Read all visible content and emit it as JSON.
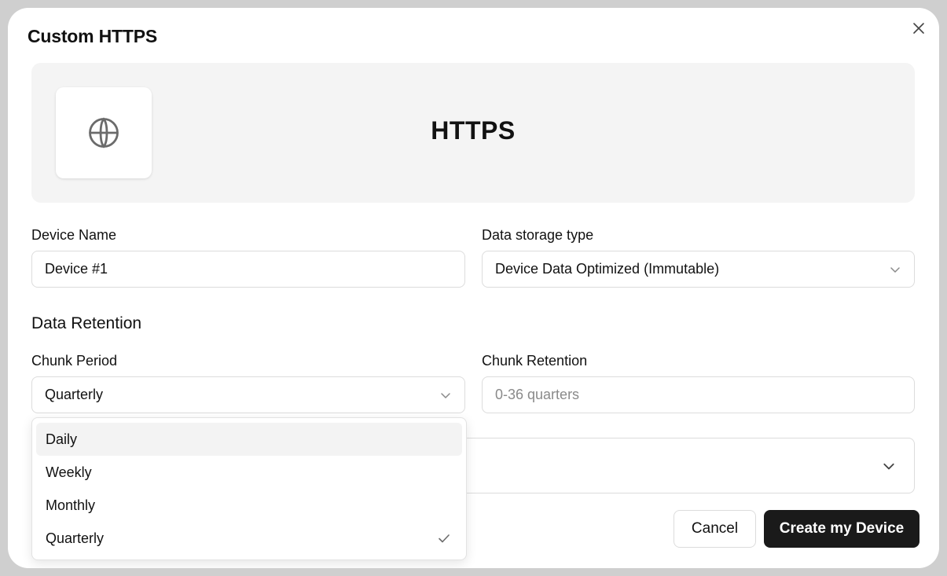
{
  "dialog": {
    "title": "Custom HTTPS",
    "close_icon": "close-icon"
  },
  "hero": {
    "icon": "globe-icon",
    "title": "HTTPS"
  },
  "device_name": {
    "label": "Device Name",
    "value": "Device #1"
  },
  "storage_type": {
    "label": "Data storage type",
    "value": "Device Data Optimized (Immutable)"
  },
  "retention": {
    "section_title": "Data Retention",
    "chunk_period": {
      "label": "Chunk Period",
      "value": "Quarterly",
      "options": [
        "Daily",
        "Weekly",
        "Monthly",
        "Quarterly"
      ],
      "highlighted": "Daily",
      "selected": "Quarterly"
    },
    "chunk_retention": {
      "label": "Chunk Retention",
      "placeholder": "0-36 quarters"
    }
  },
  "actions": {
    "cancel_label": "Cancel",
    "create_label": "Create my Device"
  },
  "colors": {
    "primary_button": "#1a1a1a",
    "hero_background": "#f4f4f4",
    "border": "#dcdcdc"
  }
}
